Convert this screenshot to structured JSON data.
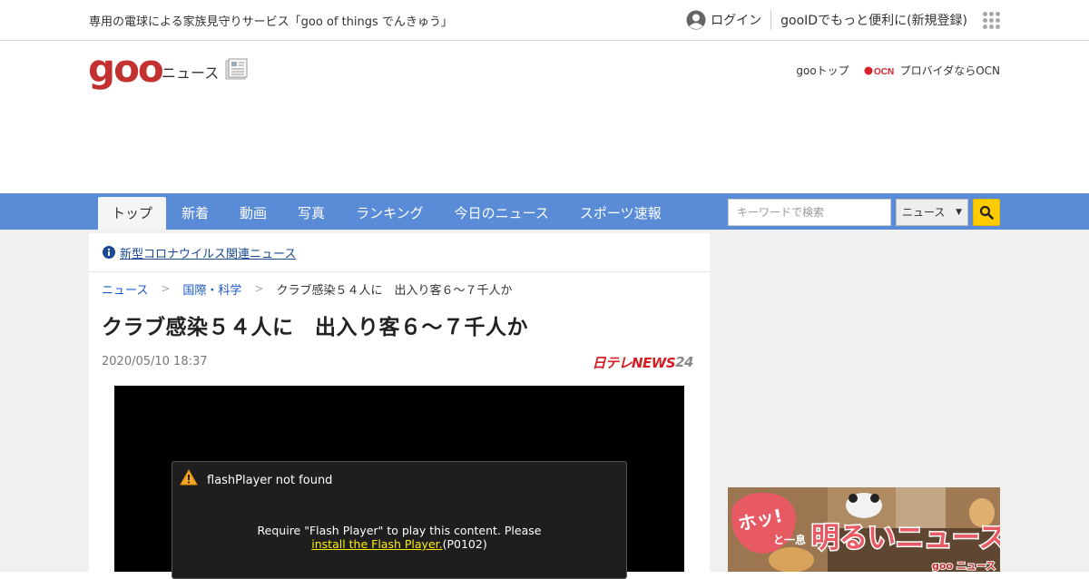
{
  "topbar": {
    "promo": "専用の電球による家族見守りサービス「goo of things でんきゅう」",
    "login": "ログイン",
    "register": "gooIDでもっと便利に(新規登録)"
  },
  "header": {
    "logo": "goo",
    "section": "ニュース",
    "goo_top": "gooトップ",
    "ocn_link": "プロバイダならOCN"
  },
  "nav": {
    "items": [
      "トップ",
      "新着",
      "動画",
      "写真",
      "ランキング",
      "今日のニュース",
      "スポーツ速報"
    ],
    "search_placeholder": "キーワードで検索",
    "search_scope": "ニュース"
  },
  "notice": {
    "corona_link": "新型コロナウイルス関連ニュース"
  },
  "breadcrumb": {
    "home": "ニュース",
    "category": "国際・科学",
    "current": "クラブ感染５４人に　出入り客６～７千人か"
  },
  "article": {
    "title": "クラブ感染５４人に　出入り客６～７千人か",
    "date": "2020/05/10 18:37",
    "source_logo_main": "日テレNEWS",
    "source_logo_num": "24"
  },
  "player": {
    "error_title": "flashPlayer not found",
    "error_line1": "Require \"Flash Player\" to play this content. Please",
    "error_link": "install the Flash Player.",
    "error_code": "(P0102)"
  },
  "banner": {
    "text_left": "ホッと一息",
    "text_main": "明るいニュース",
    "brand": "goo ニュース"
  },
  "colors": {
    "nav_bg": "#5a8bd6",
    "logo_red": "#c33030",
    "search_button": "#ffcc00",
    "link_blue": "#1a59c3"
  }
}
